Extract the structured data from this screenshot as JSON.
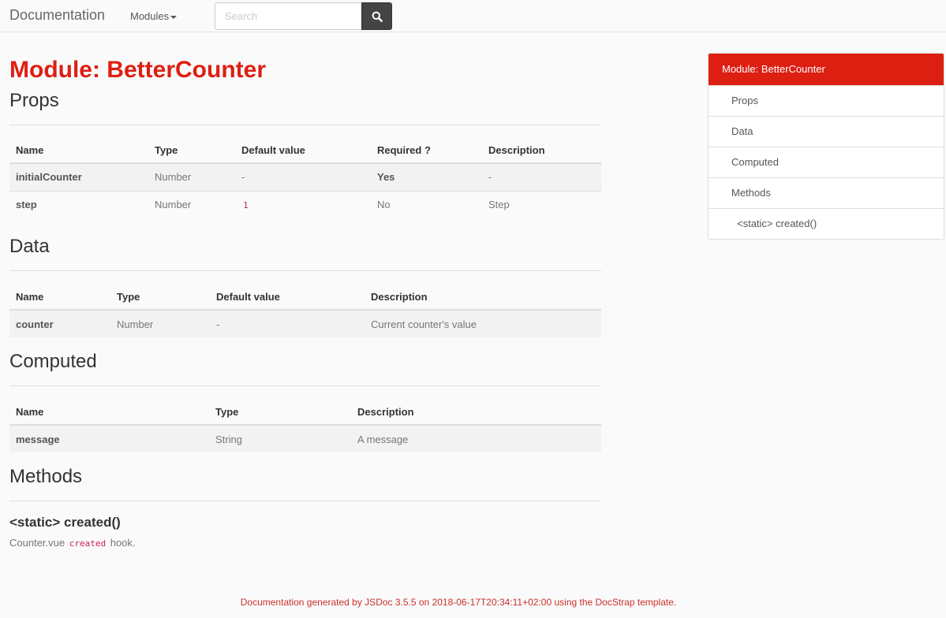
{
  "navbar": {
    "brand": "Documentation",
    "modules_label": "Modules",
    "search_placeholder": "Search"
  },
  "page": {
    "title": "Module: BetterCounter"
  },
  "props": {
    "heading": "Props",
    "columns": [
      "Name",
      "Type",
      "Default value",
      "Required ?",
      "Description"
    ],
    "rows": [
      {
        "name": "initialCounter",
        "type": "Number",
        "default": "-",
        "required": "Yes",
        "description": "-"
      },
      {
        "name": "step",
        "type": "Number",
        "default": "1",
        "required": "No",
        "description": "Step"
      }
    ]
  },
  "data_section": {
    "heading": "Data",
    "columns": [
      "Name",
      "Type",
      "Default value",
      "Description"
    ],
    "rows": [
      {
        "name": "counter",
        "type": "Number",
        "default": "-",
        "description": "Current counter's value"
      }
    ]
  },
  "computed": {
    "heading": "Computed",
    "columns": [
      "Name",
      "Type",
      "Description"
    ],
    "rows": [
      {
        "name": "message",
        "type": "String",
        "description": "A message"
      }
    ]
  },
  "methods": {
    "heading": "Methods",
    "signature": "<static> created()",
    "desc_prefix": "Counter.vue",
    "desc_code": "created",
    "desc_suffix": "hook."
  },
  "toc": {
    "items": [
      {
        "label": "Module: BetterCounter",
        "active": true
      },
      {
        "label": "Props"
      },
      {
        "label": "Data"
      },
      {
        "label": "Computed"
      },
      {
        "label": "Methods"
      },
      {
        "label": "<static> created()"
      }
    ]
  },
  "footer": {
    "text": "Documentation generated by JSDoc 3.5.5 on 2018-06-17T20:34:11+02:00 using the DocStrap template."
  },
  "colors": {
    "accent": "#dd1f12",
    "search_button": "#444444"
  },
  "icons": {
    "search": "search-icon",
    "caret": "caret-down-icon"
  }
}
